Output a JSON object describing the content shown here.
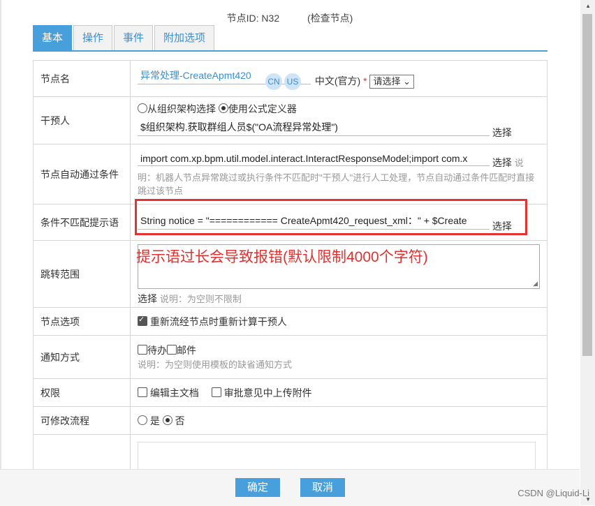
{
  "header": {
    "node_id": "节点ID: N32",
    "check": "(检查节点)"
  },
  "tabs": [
    "基本",
    "操作",
    "事件",
    "附加选项"
  ],
  "rows": {
    "node_name": {
      "label": "节点名",
      "value": "异常处理-CreateApmt420",
      "cn": "CN",
      "us": "US",
      "lang": "中文(官方)",
      "required": "*",
      "select": "请选择"
    },
    "intervener": {
      "label": "干预人",
      "radio1": "从组织架构选择",
      "radio2": "使用公式定义器",
      "formula": "$组织架构.获取群组人员$(\"OA流程异常处理\")",
      "choose": "选择"
    },
    "auto_pass": {
      "label": "节点自动通过条件",
      "value": "import com.xp.bpm.util.model.interact.InteractResponseModel;import com.x",
      "choose": "选择",
      "desc_word": "说",
      "desc": "明：机器人节点异常跳过或执行条件不匹配时\"干预人\"进行人工处理，节点自动通过条件匹配时直接跳过该节点"
    },
    "mismatch_tip": {
      "label": "条件不匹配提示语",
      "value": "String notice = \"============ CreateApmt420_request_xml：\" + $Create",
      "choose": "选择"
    },
    "jump_scope": {
      "label": "跳转范围",
      "choose": "选择",
      "desc": "说明：为空则不限制"
    },
    "node_option": {
      "label": "节点选项",
      "checkbox": "重新流经节点时重新计算干预人"
    },
    "notify": {
      "label": "通知方式",
      "todo": "待办",
      "mail": "邮件",
      "desc": "说明：为空则使用模板的缺省通知方式"
    },
    "permission": {
      "label": "权限",
      "edit_doc": "编辑主文档",
      "upload": "审批意见中上传附件"
    },
    "modify_flow": {
      "label": "可修改流程",
      "yes": "是",
      "no": "否"
    }
  },
  "annotation": "提示语过长会导致报错(默认限制4000个字符)",
  "buttons": {
    "ok": "确定",
    "cancel": "取消"
  },
  "watermark": "CSDN @Liquid-Li",
  "colors": {
    "accent": "#47a0dc",
    "highlight": "#e53333"
  }
}
